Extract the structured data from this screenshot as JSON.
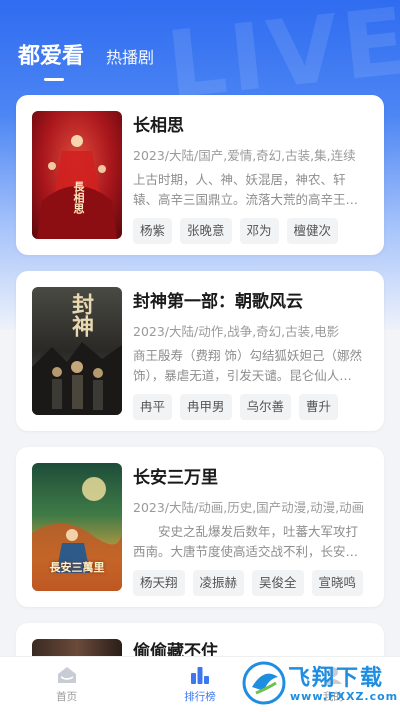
{
  "header": {
    "tabs": [
      {
        "label": "都爱看",
        "active": true
      },
      {
        "label": "热播剧",
        "active": false
      }
    ]
  },
  "dramas": [
    {
      "title": "长相思",
      "meta": "2023/大陆/国产,爱情,奇幻,古装,集,连续",
      "desc": "上古时期，人、神、妖混居，神农、轩辕、高辛三国鼎立。流落大荒的高辛王…",
      "tags": [
        "杨紫",
        "张晚意",
        "邓为",
        "檀健次"
      ],
      "poster_text": "長相思",
      "poster_colors": [
        "#7a0f12",
        "#c3272b"
      ]
    },
    {
      "title": "封神第一部：朝歌风云",
      "meta": "2023/大陆/动作,战争,奇幻,古装,电影",
      "desc": "商王殷寿（费翔 饰）勾结狐妖妲己（娜然 饰），暴虐无道，引发天谴。昆仑仙人…",
      "tags": [
        "冉平",
        "冉甲男",
        "乌尔善",
        "曹升"
      ],
      "poster_text": "封神",
      "poster_colors": [
        "#2a2a28",
        "#6d6a60"
      ]
    },
    {
      "title": "长安三万里",
      "meta": "2023/大陆/动画,历史,国产动漫,动漫,动画",
      "desc": "　　安史之乱爆发后数年，吐蕃大军攻打西南。大唐节度使高适交战不利，长安…",
      "tags": [
        "杨天翔",
        "凌振赫",
        "吴俊全",
        "宣晓鸣"
      ],
      "poster_text": "長安三萬里",
      "poster_colors": [
        "#1d3a2a",
        "#c8a040"
      ]
    },
    {
      "title": "偷偷藏不住"
    }
  ],
  "bottom_nav": [
    {
      "label": "首页",
      "icon": "home-icon",
      "active": false
    },
    {
      "label": "排行榜",
      "icon": "ranking-bars-icon",
      "active": true
    },
    {
      "label": "我的",
      "icon": "profile-icon",
      "active": false
    }
  ],
  "watermark": {
    "name": "飞翔下载",
    "url": "www.FXXZ.com"
  },
  "colors": {
    "accent": "#3b78f0",
    "hero_top": "#2f6cf0"
  }
}
